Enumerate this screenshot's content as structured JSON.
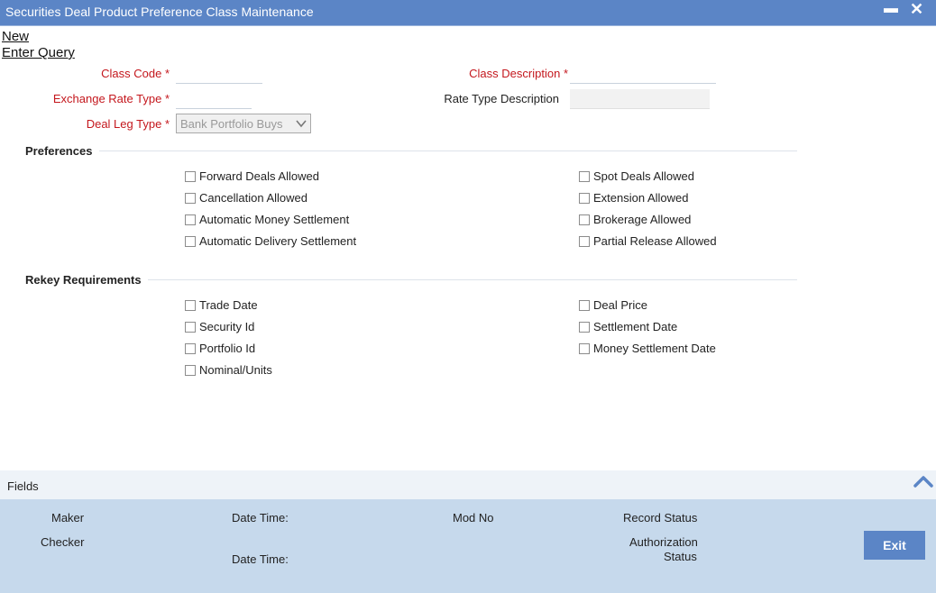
{
  "window": {
    "title": "Securities Deal Product Preference Class Maintenance",
    "minimize_glyph": "▬",
    "close_glyph": "✕"
  },
  "menu": {
    "new": "New",
    "enter_query": "Enter Query"
  },
  "form": {
    "class_code": {
      "label": "Class Code",
      "required": "*",
      "value": ""
    },
    "class_description": {
      "label": "Class Description",
      "required": "*",
      "value": ""
    },
    "exchange_rate_type": {
      "label": "Exchange Rate Type",
      "required": "*",
      "value": ""
    },
    "rate_type_description": {
      "label": "Rate Type Description",
      "value": ""
    },
    "deal_leg_type": {
      "label": "Deal Leg Type",
      "required": "*",
      "selected": "Bank Portfolio Buys"
    }
  },
  "preferences": {
    "title": "Preferences",
    "left": [
      "Forward Deals Allowed",
      "Cancellation Allowed",
      "Automatic Money Settlement",
      "Automatic Delivery Settlement"
    ],
    "right": [
      "Spot Deals Allowed",
      "Extension Allowed",
      "Brokerage Allowed",
      "Partial Release Allowed"
    ]
  },
  "rekey": {
    "title": "Rekey Requirements",
    "left": [
      "Trade Date",
      "Security Id",
      "Portfolio Id",
      "Nominal/Units"
    ],
    "right": [
      "Deal Price",
      "Settlement Date",
      "Money Settlement Date"
    ]
  },
  "fields_bar": {
    "label": "Fields",
    "icon": "chevron-up-icon"
  },
  "audit": {
    "maker": "Maker",
    "checker": "Checker",
    "maker_date_time": "Date Time:",
    "checker_date_time": "Date Time:",
    "mod_no": "Mod No",
    "record_status": "Record Status",
    "authorization_line1": "Authorization",
    "authorization_line2": "Status",
    "exit": "Exit"
  },
  "colors": {
    "title_bar": "#5b85c6",
    "required_label": "#c4171d",
    "audit_panel": "#c6d9ec",
    "exit_button": "#5b85c6"
  }
}
